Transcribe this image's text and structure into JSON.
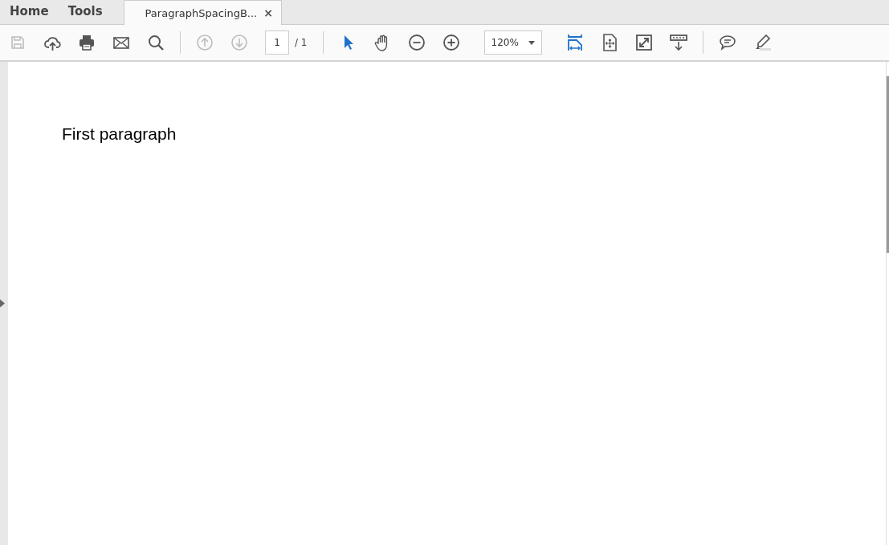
{
  "nav_tabs": [
    {
      "label": "Home",
      "selected": false
    },
    {
      "label": "Tools",
      "selected": false
    }
  ],
  "document_tab": {
    "title": "ParagraphSpacingB...",
    "close": "×",
    "selected": true
  },
  "toolbar": {
    "groups": [
      [
        {
          "kind": "save",
          "disabled": true,
          "selected": false
        },
        {
          "kind": "upload",
          "disabled": false,
          "selected": false
        },
        {
          "kind": "print",
          "disabled": false,
          "selected": false
        },
        {
          "kind": "mail",
          "disabled": false,
          "selected": false
        },
        {
          "kind": "search",
          "disabled": false,
          "selected": false
        }
      ],
      [
        {
          "kind": "prev",
          "disabled": true,
          "selected": false
        },
        {
          "kind": "next",
          "disabled": true,
          "selected": false
        },
        {
          "kind": "page",
          "value": "1",
          "total": "/ 1"
        }
      ],
      [
        {
          "kind": "select",
          "disabled": false,
          "selected": true
        },
        {
          "kind": "hand",
          "disabled": false,
          "selected": false
        },
        {
          "kind": "zoomout",
          "disabled": false,
          "selected": false
        },
        {
          "kind": "zoomin",
          "disabled": false,
          "selected": false
        },
        {
          "kind": "zoom",
          "value": "120%"
        },
        {
          "kind": "fitwidth",
          "disabled": false,
          "selected": true
        },
        {
          "kind": "fitpage",
          "disabled": false,
          "selected": false
        },
        {
          "kind": "fullscreen",
          "disabled": false,
          "selected": false
        },
        {
          "kind": "readmode",
          "disabled": false,
          "selected": false
        }
      ],
      [
        {
          "kind": "comment",
          "disabled": false,
          "selected": false
        },
        {
          "kind": "highlight",
          "disabled": false,
          "selected": false
        }
      ]
    ]
  },
  "document": {
    "paragraphs": [
      "First paragraph"
    ]
  }
}
